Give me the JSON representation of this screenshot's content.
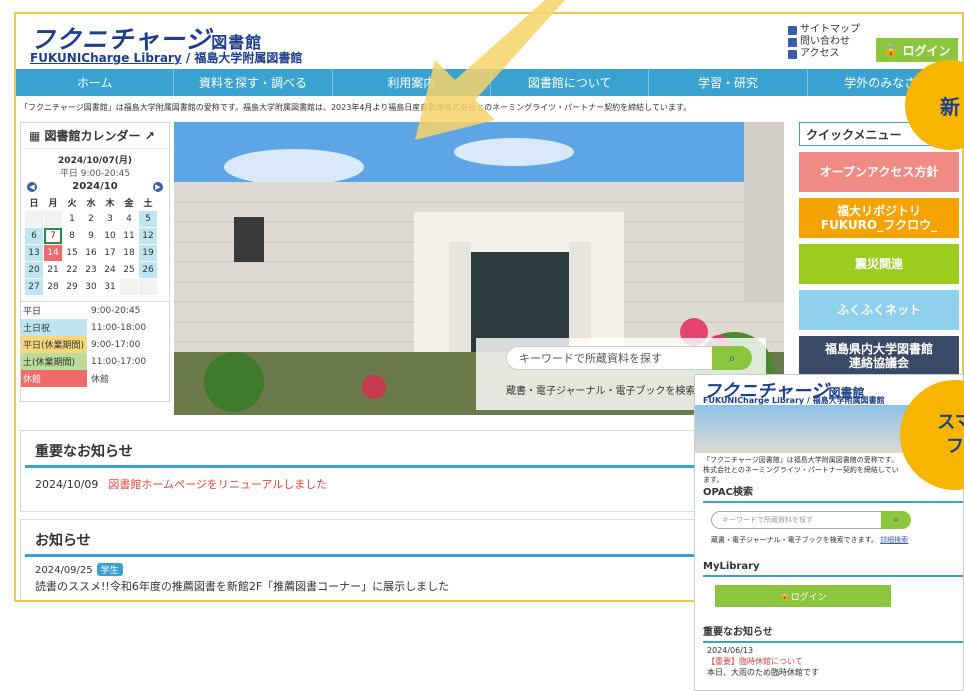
{
  "header": {
    "logo_jp": "フクニチャージ",
    "logo_lib": "図書館",
    "logo_en": "FUKUNICharge Library",
    "logo_sub": "/ 福島大学附属図書館",
    "links": [
      "サイトマップ",
      "問い合わせ",
      "アクセス"
    ],
    "login": "ログイン"
  },
  "nav": [
    "ホーム",
    "資料を探す・調べる",
    "利用案内",
    "図書館について",
    "学習・研究",
    "学外のみなさま"
  ],
  "notice": "「フクニチャージ図書館」は福島大学附属図書館の愛称です。福島大学附属図書館は、2023年4月より福島日産自動車株式会社とのネーミングライツ・パートナー契約を締結しています。",
  "calendar": {
    "title": "図書館カレンダー",
    "date": "2024/10/07(月)",
    "hours": "平日 9:00-20:45",
    "month": "2024/10",
    "weekdays": [
      "日",
      "月",
      "火",
      "水",
      "木",
      "金",
      "土"
    ],
    "days": [
      "",
      "",
      "1",
      "2",
      "3",
      "4",
      "5",
      "6",
      "7",
      "8",
      "9",
      "10",
      "11",
      "12",
      "13",
      "14",
      "15",
      "16",
      "17",
      "18",
      "19",
      "20",
      "21",
      "22",
      "23",
      "24",
      "25",
      "26",
      "27",
      "28",
      "29",
      "30",
      "31",
      "",
      ""
    ],
    "legend": [
      {
        "key": "平日",
        "value": "9:00-20:45",
        "color": "#ffffff"
      },
      {
        "key": "土日祝",
        "value": "11:00-18:00",
        "color": "#bfe6f0"
      },
      {
        "key": "平日(休業期間)",
        "value": "9:00-17:00",
        "color": "#f7d77c"
      },
      {
        "key": "土(休業期間)",
        "value": "11:00-17:00",
        "color": "#b9dc9a"
      },
      {
        "key": "休館",
        "value": "休館",
        "color": "#ef6b6b"
      }
    ]
  },
  "search": {
    "placeholder": "キーワードで所蔵資料を探す",
    "help": "蔵書・電子ジャーナル・電子ブックを検索でき"
  },
  "quick_menu": {
    "title": "クイックメニュー",
    "items": [
      {
        "label": "オープンアクセス方針",
        "color": "#f08a84"
      },
      {
        "label": "福大リポジトリ\nFUKURO_フクロウ_",
        "color": "#f5a300"
      },
      {
        "label": "震災関連",
        "color": "#9ccc1e"
      },
      {
        "label": "ふくふくネット",
        "color": "#8fd0ec"
      },
      {
        "label": "福島県内大学図書館\n連絡協議会",
        "color": "#3a4a66"
      }
    ]
  },
  "important": {
    "title": "重要なお知らせ",
    "date": "2024/10/09",
    "text": "図書館ホームページをリニューアルしました"
  },
  "news": {
    "title": "お知らせ",
    "date": "2024/09/25",
    "badge": "学生",
    "text": "読書のススメ!!令和6年度の推薦図書を新館2F「推薦図書コーナー」に展示しました"
  },
  "mobile": {
    "logo_jp": "フクニチャージ",
    "logo_lib": "図書館",
    "logo_sub": "FUKUNICharge Library / 福島大学附属図書館",
    "notice": "「フクニチャージ図書館」は福島大学附属図書館の愛称です。株式会社とのネーミングライツ・パートナー契約を締結しています。",
    "opac_title": "OPAC検索",
    "opac_placeholder": "キーワードで所蔵資料を探す",
    "opac_help": "蔵書・電子ジャーナル・電子ブックを検索できます。",
    "opac_link": "詳細検索",
    "mylib_title": "MyLibrary",
    "login": "ログイン",
    "imp_title": "重要なお知らせ",
    "imp_date": "2024/06/13",
    "imp_text": "【重要】臨時休館について",
    "imp_body": "本日、大雨のため臨時休館です"
  },
  "bubbles": {
    "right": "新",
    "mobile": "スマ\nフ"
  }
}
